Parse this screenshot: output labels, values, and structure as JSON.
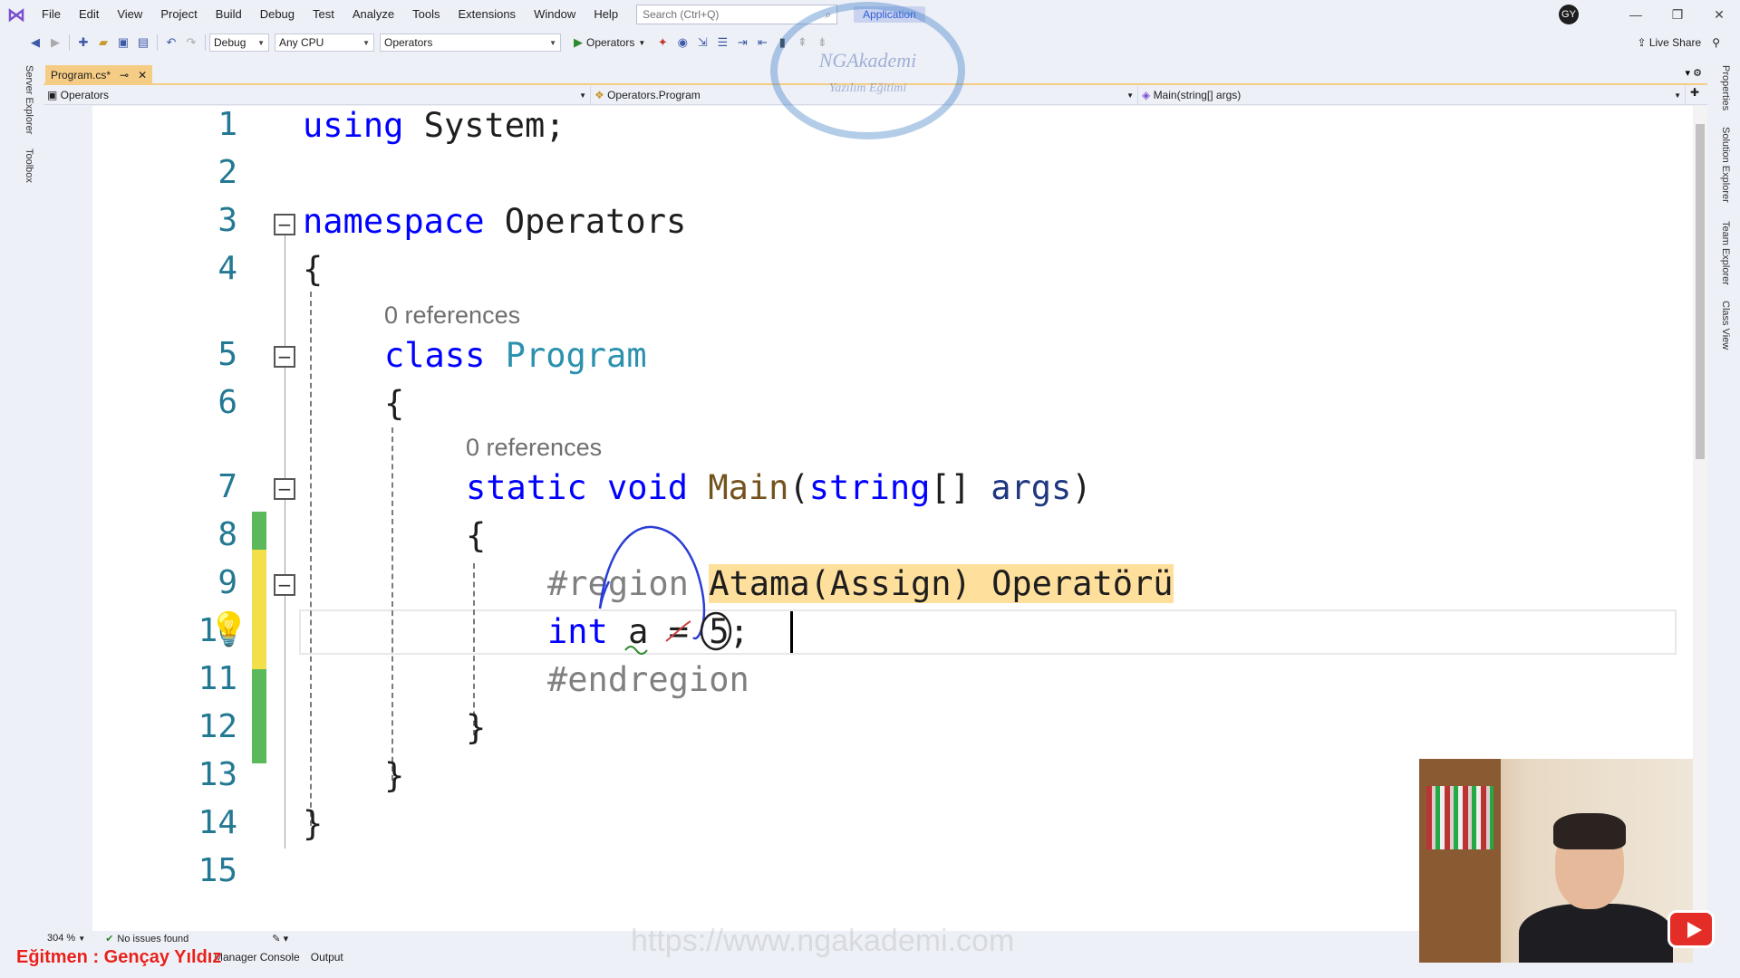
{
  "menu": {
    "items": [
      "File",
      "Edit",
      "View",
      "Project",
      "Build",
      "Debug",
      "Test",
      "Analyze",
      "Tools",
      "Extensions",
      "Window",
      "Help"
    ],
    "search_placeholder": "Search (Ctrl+Q)",
    "app_badge": "Application",
    "user_initials": "GY"
  },
  "toolbar": {
    "config": "Debug",
    "platform": "Any CPU",
    "startup_project": "Operators",
    "run_label": "Operators",
    "live_share": "Live Share"
  },
  "side_panels": {
    "left": [
      "Server Explorer",
      "Toolbox"
    ],
    "right": [
      "Properties",
      "Solution Explorer",
      "Team Explorer",
      "Class View"
    ]
  },
  "document_tab": {
    "name": "Program.cs*"
  },
  "navigation": {
    "project": "Operators",
    "type": "Operators.Program",
    "member": "Main(string[] args)"
  },
  "editor": {
    "line_numbers": [
      "1",
      "2",
      "3",
      "4",
      "5",
      "6",
      "7",
      "8",
      "9",
      "10",
      "11",
      "12",
      "13",
      "14",
      "15"
    ],
    "codelens_class": "0 references",
    "codelens_method": "0 references",
    "code": {
      "l1_kw": "using",
      "l1_rest": " System;",
      "l3_kw": "namespace",
      "l3_rest": " Operators",
      "open_brace": "{",
      "close_brace": "}",
      "l5_kw": "class",
      "l5_name": "Program",
      "l7_static": "static",
      "l7_void": "void",
      "l7_method": "Main",
      "l7_paren_open": "(",
      "l7_type": "string",
      "l7_brackets": "[] ",
      "l7_param": "args",
      "l7_paren_close": ")",
      "l9_region": "#region ",
      "l9_region_name": "Atama(Assign) Operatörü",
      "l10_kw": "int",
      "l10_rest": " a = 5;",
      "l11_endregion": "#endregion"
    }
  },
  "watermark": {
    "line1": "NGAkademi",
    "line2": "Yazılım Eğitimi"
  },
  "status": {
    "zoom": "304 %",
    "issues": "No issues found"
  },
  "bottom_tabs": [
    "Manager Console",
    "Output"
  ],
  "overlay": {
    "instructor": "Eğitmen : Gençay Yıldız",
    "url": "https://www.ngakademi.com"
  }
}
